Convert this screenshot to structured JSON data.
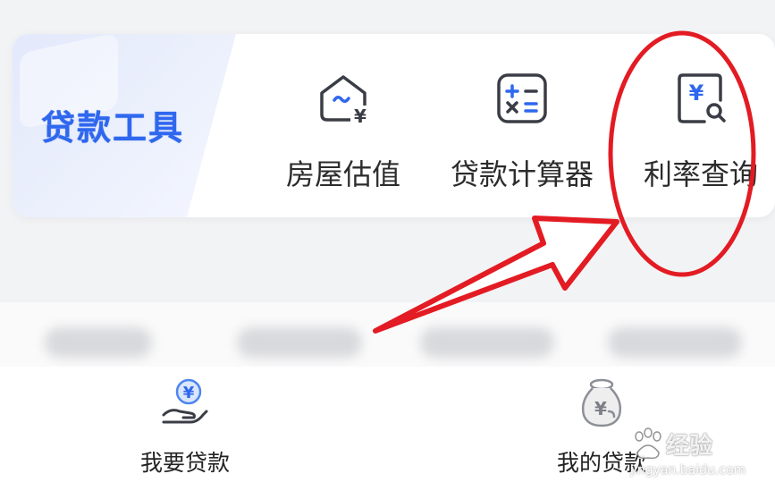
{
  "loan_tools": {
    "title": "贷款工具",
    "items": [
      {
        "label": "房屋估值",
        "icon": "house-valuation-icon"
      },
      {
        "label": "贷款计算器",
        "icon": "calculator-icon"
      },
      {
        "label": "利率查询",
        "icon": "rate-search-icon"
      }
    ]
  },
  "tab_bar": {
    "items": [
      {
        "label": "我要贷款",
        "icon": "hand-coin-icon"
      },
      {
        "label": "我的贷款",
        "icon": "money-bag-icon"
      }
    ]
  },
  "watermark": {
    "text": "经验",
    "url": "jingyan.baidu.com"
  },
  "colors": {
    "brand_blue": "#2f67ee",
    "annotation_red": "#e31b23",
    "icon_stroke": "#3a3d45"
  }
}
